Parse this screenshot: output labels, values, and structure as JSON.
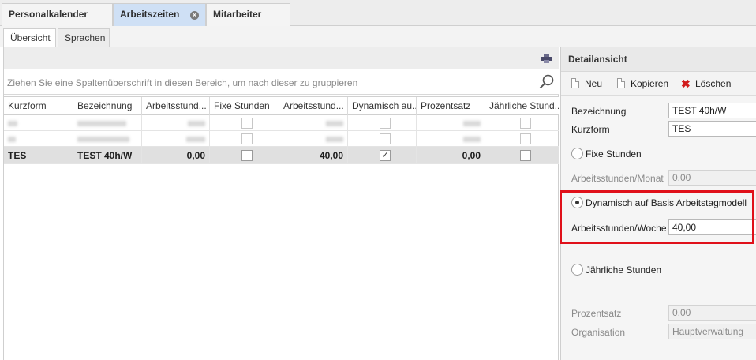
{
  "doc_tabs": [
    {
      "label": "Personalkalender"
    },
    {
      "label": "Arbeitszeiten",
      "active": true
    },
    {
      "label": "Mitarbeiter"
    }
  ],
  "sub_tabs": [
    {
      "label": "Übersicht",
      "active": true
    },
    {
      "label": "Sprachen"
    }
  ],
  "grid": {
    "group_hint": "Ziehen Sie eine Spaltenüberschrift in diesen Bereich, um nach dieser zu gruppieren",
    "columns": [
      "Kurzform",
      "Bezeichnung",
      "Arbeitsstund...",
      "Fixe Stunden",
      "Arbeitsstund...",
      "Dynamisch au...",
      "Prozentsatz",
      "Jährliche Stund..."
    ],
    "selected_row": {
      "kurzform": "TES",
      "bezeichnung": "TEST 40h/W",
      "arbeitsstunden_monat": "0,00",
      "arbeitsstunden_woche": "40,00",
      "prozentsatz": "0,00",
      "dynamisch_checked": "✓"
    }
  },
  "detail": {
    "title": "Detailansicht",
    "toolbar": {
      "new": "Neu",
      "copy": "Kopieren",
      "delete": "Löschen"
    },
    "bezeichnung_label": "Bezeichnung",
    "bezeichnung_value": "TEST 40h/W",
    "kurzform_label": "Kurzform",
    "kurzform_value": "TES",
    "fixe_stunden_label": "Fixe Stunden",
    "arbeitsstunden_monat_label": "Arbeitsstunden/Monat",
    "arbeitsstunden_monat_value": "0,00",
    "dynamisch_label": "Dynamisch auf Basis Arbeitstagmodell",
    "arbeitsstunden_woche_label": "Arbeitsstunden/Woche",
    "arbeitsstunden_woche_value": "40,00",
    "jaehrliche_label": "Jährliche Stunden",
    "prozentsatz_label": "Prozentsatz",
    "prozentsatz_value": "0,00",
    "organisation_label": "Organisation",
    "organisation_value": "Hauptverwaltung"
  },
  "colors": {
    "highlight": "#e0101a",
    "active_tab": "#cfe0f5",
    "delete": "#d11c1c"
  }
}
